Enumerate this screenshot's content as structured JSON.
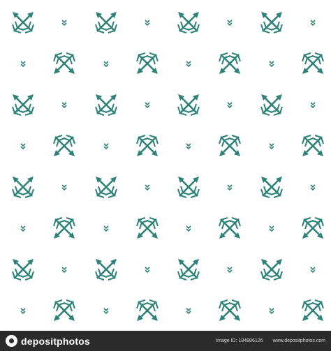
{
  "pattern": {
    "accent_color": "#2e8277",
    "background_color": "#ffffff",
    "motif": "crossed-arrows-icon",
    "filler": "double-chevron-icon"
  },
  "footer": {
    "brand": "depositphotos",
    "image_id_label": "Image ID: 184886126",
    "site": "www.depositphotos.com",
    "background_color": "#2b2b2b"
  }
}
